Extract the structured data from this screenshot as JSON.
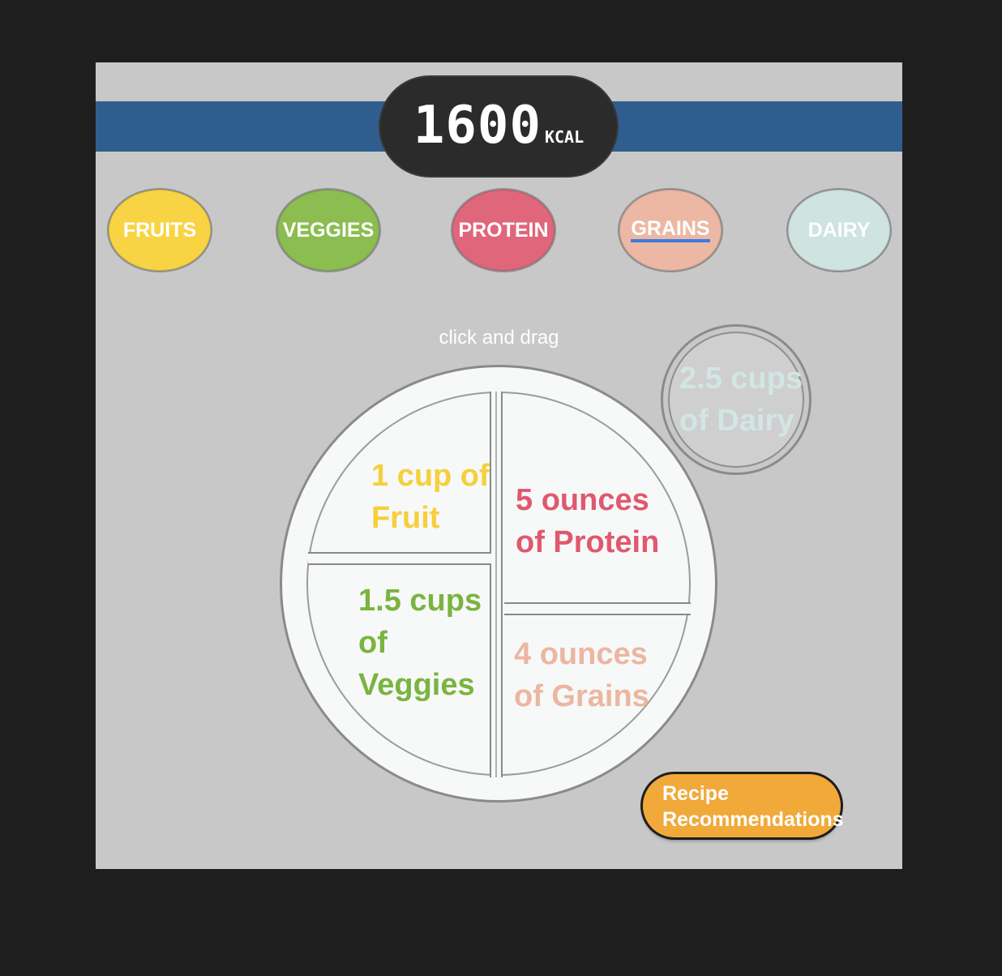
{
  "header": {
    "calories_value": "1600",
    "calories_unit": "KCAL"
  },
  "food_groups": [
    {
      "label": "FRUITS",
      "color": "#f8d444",
      "active": false
    },
    {
      "label": "VEGGIES",
      "color": "#8bbd51",
      "active": false
    },
    {
      "label": "PROTEIN",
      "color": "#e0667b",
      "active": false
    },
    {
      "label": "GRAINS",
      "color": "#ecb8a4",
      "active": true
    },
    {
      "label": "DAIRY",
      "color": "#cfe3e1",
      "active": false
    }
  ],
  "hint_text": "click and drag",
  "plate": {
    "fruit": {
      "line1": "1 cup of",
      "line2": "Fruit",
      "color": "#f6cf3b"
    },
    "protein": {
      "line1": "5 ounces",
      "line2": "of Protein",
      "color": "#e0586e"
    },
    "veggies": {
      "line1": "1.5 cups",
      "line2": "of",
      "line3": "Veggies",
      "color": "#7ab440"
    },
    "grains": {
      "line1": "4 ounces",
      "line2": "of Grains",
      "color": "#ecb6a0"
    }
  },
  "dairy": {
    "line1": "2.5 cups",
    "line2": "of Dairy",
    "color": "#d2e6e3"
  },
  "recipe_button": {
    "line1": "Recipe",
    "line2": "Recommendations"
  }
}
